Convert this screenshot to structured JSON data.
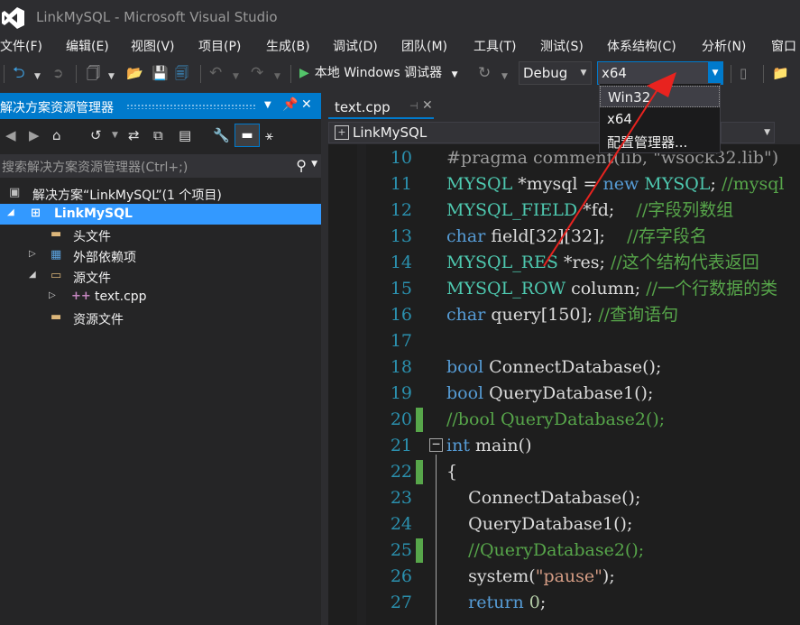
{
  "window": {
    "title": "LinkMySQL - Microsoft Visual Studio"
  },
  "menu": [
    "文件(F)",
    "编辑(E)",
    "视图(V)",
    "项目(P)",
    "生成(B)",
    "调试(D)",
    "团队(M)",
    "工具(T)",
    "测试(S)",
    "体系结构(C)",
    "分析(N)",
    "窗口"
  ],
  "toolbar": {
    "debugger_label": "本地 Windows 调试器",
    "config_value": "Debug",
    "platform_value": "x64"
  },
  "platform_options": [
    "Win32",
    "x64",
    "配置管理器..."
  ],
  "solution_explorer": {
    "title": "解决方案资源管理器",
    "search_placeholder": "搜索解决方案资源管理器(Ctrl+;)",
    "tree": [
      {
        "label": "解决方案“LinkMySQL”(1 个项目)",
        "icon": "solution-icon"
      },
      {
        "label": "LinkMySQL",
        "icon": "cpp-project-icon",
        "selected": true
      },
      {
        "label": "头文件",
        "icon": "folder-icon"
      },
      {
        "label": "外部依赖项",
        "icon": "external-deps-icon"
      },
      {
        "label": "源文件",
        "icon": "folder-icon"
      },
      {
        "label": "text.cpp",
        "icon": "cpp-file-icon"
      },
      {
        "label": "资源文件",
        "icon": "folder-icon"
      }
    ]
  },
  "editor": {
    "tab_label": "text.cpp",
    "nav_scope": "LinkMySQL",
    "lines": [
      {
        "num": "10",
        "text": "#pragma comment(lib, \"wsock32.lib\")"
      },
      {
        "num": "11",
        "text": "MYSQL *mysql = new MYSQL; //mysql"
      },
      {
        "num": "12",
        "text": "MYSQL_FIELD *fd;    //字段列数组"
      },
      {
        "num": "13",
        "text": "char field[32][32];    //存字段名"
      },
      {
        "num": "14",
        "text": "MYSQL_RES *res; //这个结构代表返回"
      },
      {
        "num": "15",
        "text": "MYSQL_ROW column; //一个行数据的类"
      },
      {
        "num": "16",
        "text": "char query[150]; //查询语句"
      },
      {
        "num": "17",
        "text": ""
      },
      {
        "num": "18",
        "text": "bool ConnectDatabase();"
      },
      {
        "num": "19",
        "text": "bool QueryDatabase1();"
      },
      {
        "num": "20",
        "text": "//bool QueryDatabase2();"
      },
      {
        "num": "21",
        "text": "int main()"
      },
      {
        "num": "22",
        "text": "{"
      },
      {
        "num": "23",
        "text": "    ConnectDatabase();"
      },
      {
        "num": "24",
        "text": "    QueryDatabase1();"
      },
      {
        "num": "25",
        "text": "    //QueryDatabase2();"
      },
      {
        "num": "26",
        "text": "    system(\"pause\");"
      },
      {
        "num": "27",
        "text": "    return 0;"
      }
    ]
  },
  "colors": {
    "accent": "#007acc",
    "keyword": "#569cd6",
    "type": "#4ec9b0",
    "comment": "#57a64a",
    "string": "#d69d85",
    "line_number": "#2b91af",
    "annotation_arrow": "#e8231f"
  }
}
